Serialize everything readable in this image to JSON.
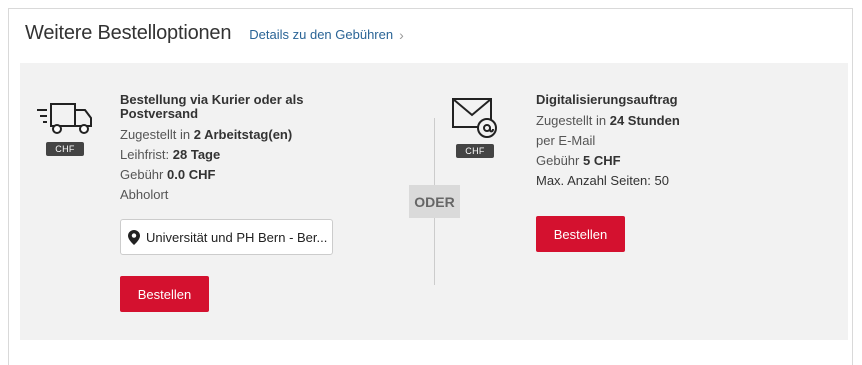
{
  "header": {
    "title": "Weitere Bestelloptionen",
    "details_link": "Details zu den Gebühren",
    "details_chevron": "›"
  },
  "courier": {
    "icon": "truck-icon",
    "currency_badge": "CHF",
    "heading": "Bestellung via Kurier oder als Postversand",
    "delivered_prefix": "Zugestellt in",
    "delivered_value": "2 Arbeitstag(en)",
    "loan_prefix": "Leihfrist:",
    "loan_value": "28 Tage",
    "fee_prefix": "Gebühr",
    "fee_value": "0.0",
    "fee_currency": "CHF",
    "pickup_label": "Abholort",
    "pickup_location": "Universität und PH Bern - Ber...",
    "order_button": "Bestellen"
  },
  "separator": "ODER",
  "digitization": {
    "icon": "mail-at-icon",
    "currency_badge": "CHF",
    "heading": "Digitalisierungsauftrag",
    "delivered_prefix": "Zugestellt in",
    "delivered_value": "24 Stunden",
    "channel": "per E-Mail",
    "fee_prefix": "Gebühr",
    "fee_value": "5",
    "fee_currency": "CHF",
    "max_pages": "Max. Anzahl Seiten: 50",
    "order_button": "Bestellen"
  },
  "colors": {
    "accent": "#d4112f",
    "link": "#2a6496",
    "panel_bg": "#f2f2f2"
  }
}
